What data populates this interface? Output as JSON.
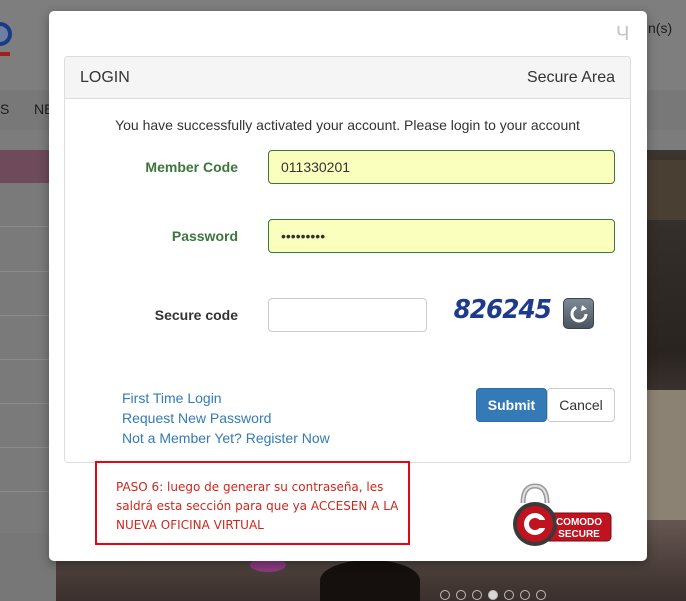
{
  "background": {
    "signin_text": "n(s)",
    "nav_items": [
      "S",
      "NE"
    ],
    "carousel": {
      "total": 7,
      "active": 4
    }
  },
  "modal": {
    "close_label": "Ч",
    "panel": {
      "title": "LOGIN",
      "secure_area": "Secure Area",
      "success_message": "You have successfully activated your account. Please login to your account"
    },
    "form": {
      "member_code": {
        "label": "Member Code",
        "value": "011330201"
      },
      "password": {
        "label": "Password",
        "value": "•••••••••"
      },
      "secure_code": {
        "label": "Secure code",
        "value": "",
        "captcha": "826245"
      }
    },
    "links": {
      "first_time_login": "First Time Login",
      "request_new_password": "Request New Password",
      "register": "Not a Member Yet? Register Now"
    },
    "buttons": {
      "submit": "Submit",
      "cancel": "Cancel"
    },
    "annotation": "PASO 6: luego de generar su contraseña, les saldrá esta sección para que ya ACCESEN A LA NUEVA OFICINA VIRTUAL",
    "badge": {
      "line1": "COMODO",
      "line2": "SECURE"
    }
  },
  "colors": {
    "label_green": "#3c763d",
    "link_blue": "#337ab7",
    "submit_blue": "#337ab7",
    "autofill_yellow": "#faffbd",
    "annotation_red": "#e30613",
    "comodo_red": "#c1121f"
  }
}
